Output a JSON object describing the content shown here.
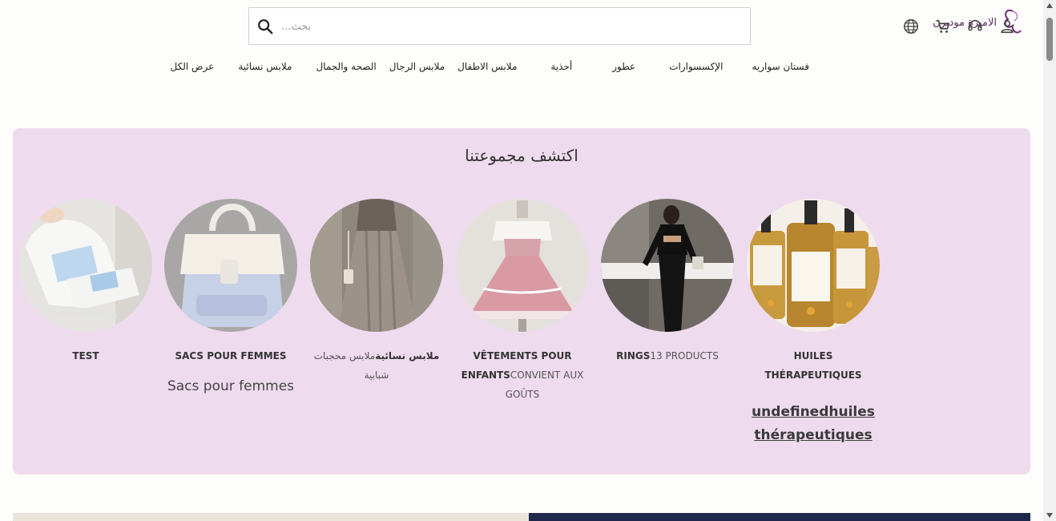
{
  "header": {
    "logo_text": "الاميرة مودبرن",
    "search_placeholder": "بحث...",
    "icons": [
      "account-icon",
      "support-icon",
      "cart-icon",
      "language-icon"
    ]
  },
  "nav": {
    "items": [
      "فستان سواريه",
      "الإكسسوارات",
      "عطور",
      "أحذية",
      "ملابس الاطفال",
      "ملابس الرجال",
      "الصحه والجمال",
      "ملابس نسائية",
      "عرض الكل"
    ]
  },
  "collection": {
    "title": "اكتشف مجموعتنا",
    "cards": [
      {
        "label_bold": "HUILES THÉRAPEUTIQUES",
        "label_thin": "",
        "link": "undefinedhuiles thérapeutiques"
      },
      {
        "label_bold": "RINGS",
        "label_thin": "13 PRODUCTS"
      },
      {
        "label_bold": "VÊTEMENTS POUR ENFANTS",
        "label_thin": "CONVIENT AUX GOÛTS"
      },
      {
        "label_bold": "ملابس نسائية",
        "label_thin": "ملابس محجبات شبابية"
      },
      {
        "label_bold": "SACS POUR FEMMES",
        "label_thin": "",
        "extra": "Sacs pour femmes"
      },
      {
        "label_bold": "TEST",
        "label_thin": ""
      }
    ]
  },
  "colors": {
    "panel_bg": "#efdbee",
    "brand": "#5a2a5e"
  }
}
